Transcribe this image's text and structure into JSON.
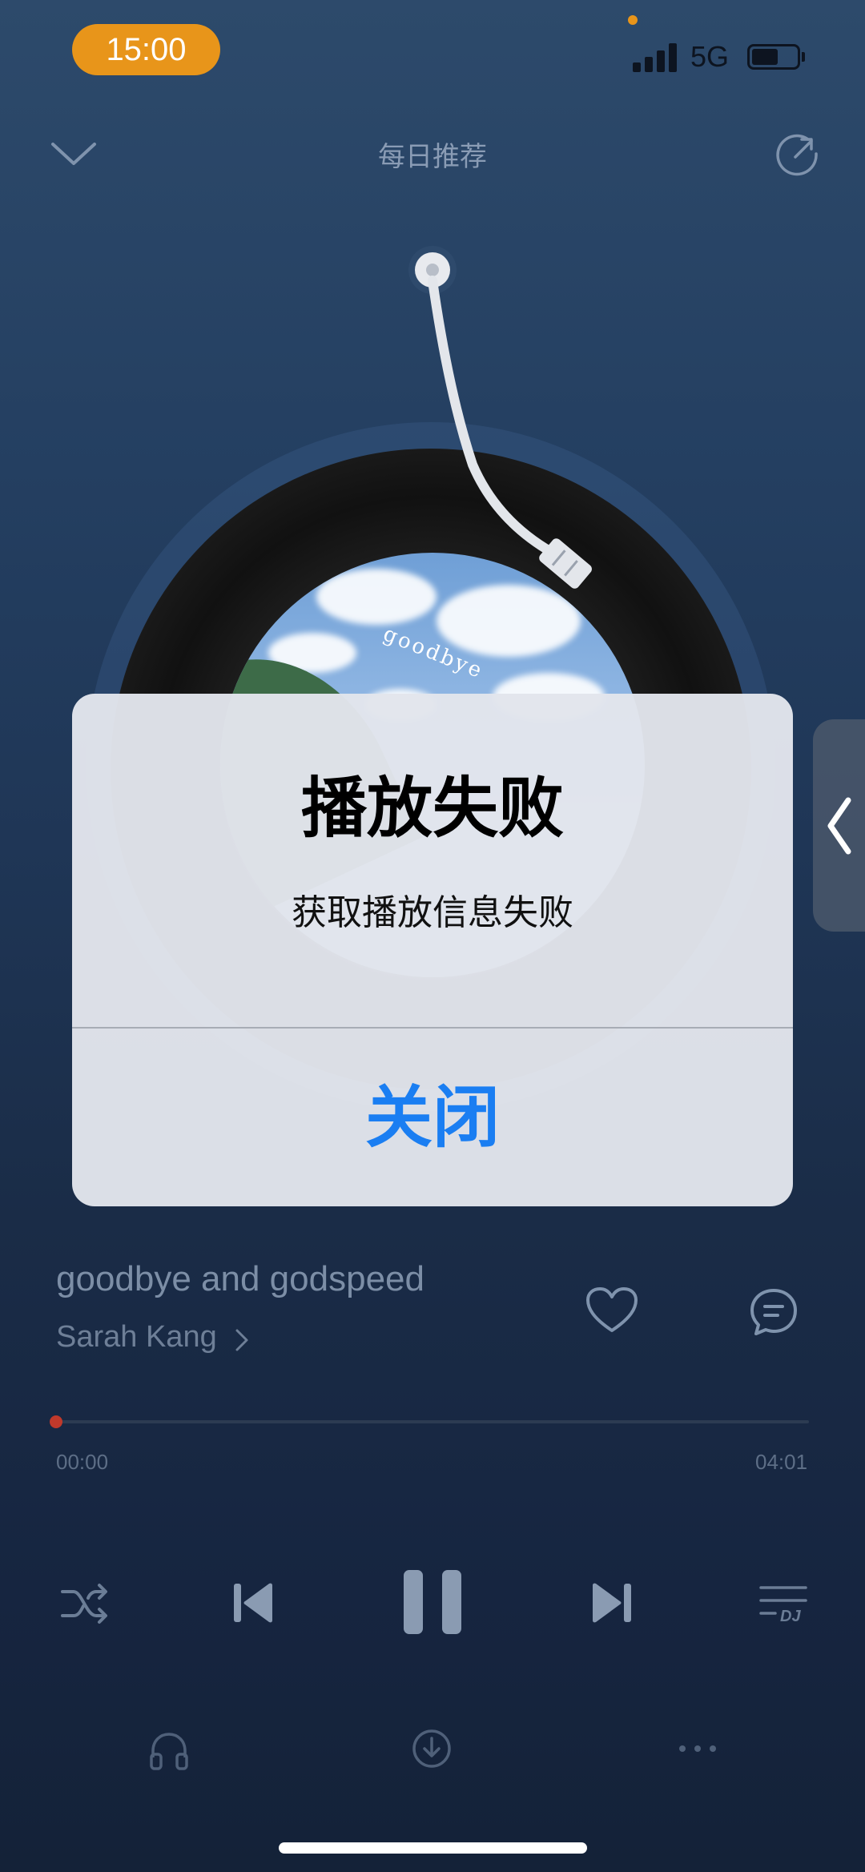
{
  "status_bar": {
    "time": "15:00",
    "network": "5G",
    "battery_level": 0.6,
    "signal_bars": 4
  },
  "header": {
    "title": "每日推荐",
    "collapse_icon": "chevron-down-icon",
    "share_icon": "share-icon"
  },
  "album": {
    "art_text": "goodbye"
  },
  "dialog": {
    "title": "播放失败",
    "message": "获取播放信息失败",
    "close_label": "关闭"
  },
  "song": {
    "title": "goodbye and godspeed",
    "artist": "Sarah Kang"
  },
  "progress": {
    "elapsed": "00:00",
    "total": "04:01",
    "fraction": 0.0
  },
  "controls": {
    "shuffle_icon": "shuffle-icon",
    "prev_icon": "previous-icon",
    "pause_icon": "pause-icon",
    "next_icon": "next-icon",
    "dj_icon": "dj-playlist-icon",
    "dj_label": "DJ"
  },
  "bottom_bar": {
    "headphone_icon": "headphones-icon",
    "download_icon": "download-icon",
    "more_icon": "more-icon"
  },
  "colors": {
    "accent_orange": "#e8951a",
    "dialog_button_blue": "#1a7ef2",
    "progress_red": "#c0392b"
  }
}
